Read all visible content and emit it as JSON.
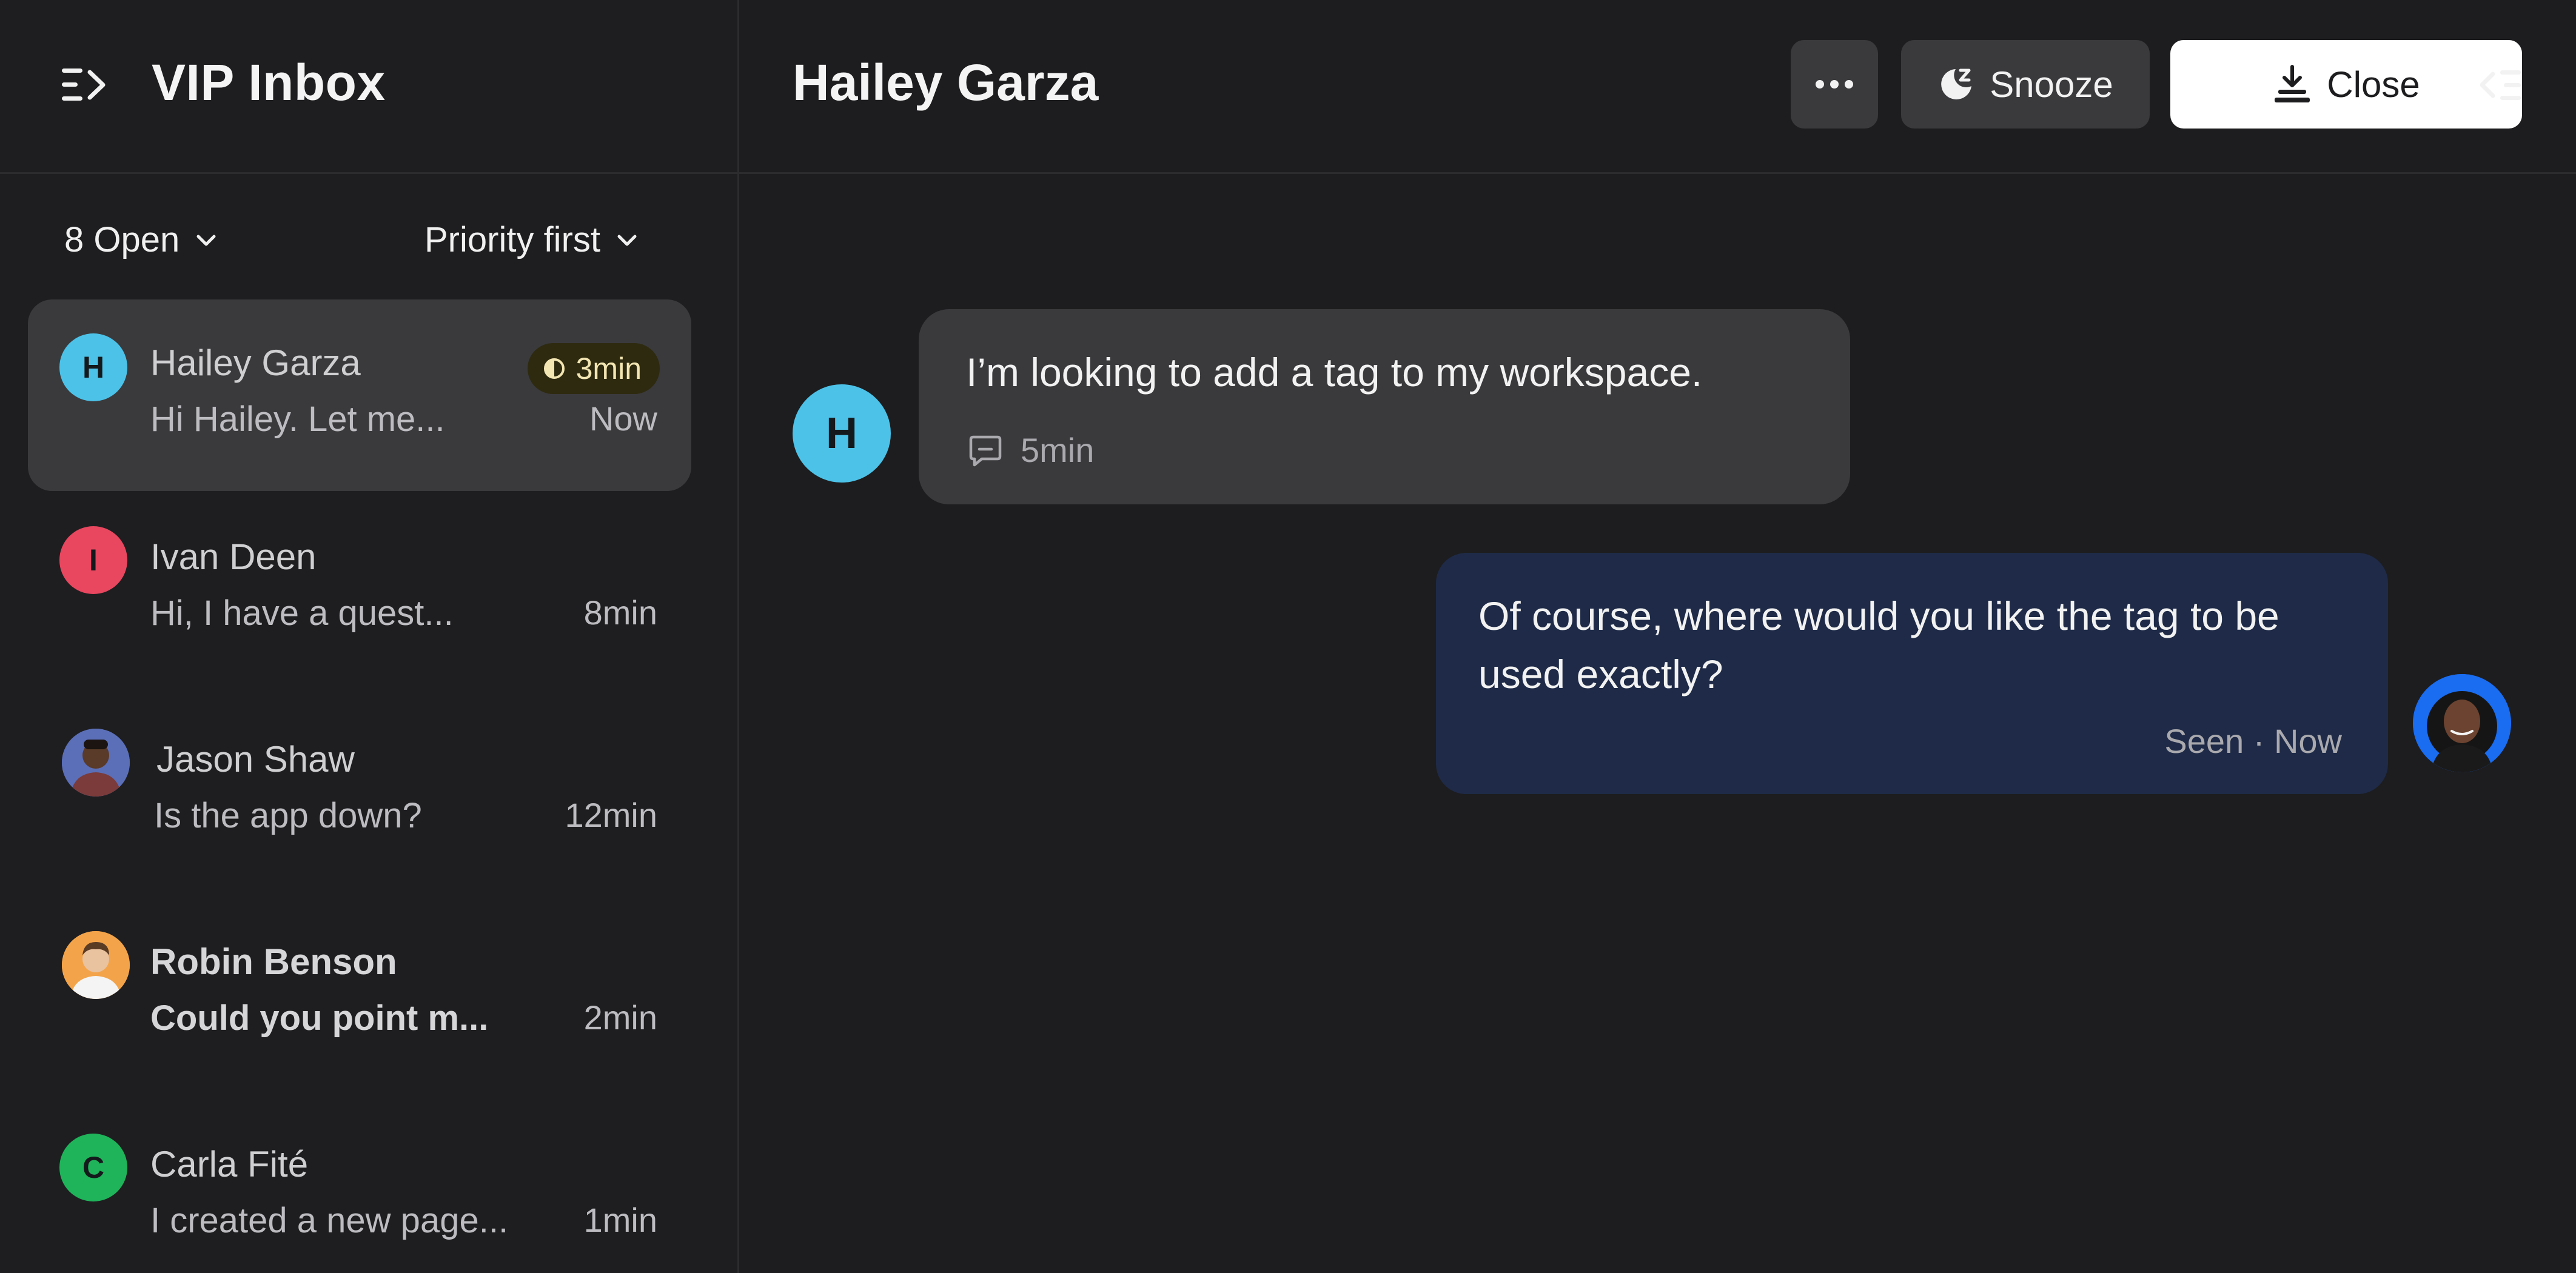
{
  "sidebar": {
    "title": "VIP Inbox",
    "filter_open": "8 Open",
    "filter_sort": "Priority first",
    "conversations": [
      {
        "initial": "H",
        "name": "Hailey Garza",
        "preview": "Hi Hailey. Let me...",
        "time": "Now",
        "badge": "3min",
        "avatar_color": "#4cc2e8",
        "active": true,
        "bold": false
      },
      {
        "initial": "I",
        "name": "Ivan Deen",
        "preview": "Hi, I have a quest...",
        "time": "8min",
        "avatar_color": "#e8475f",
        "active": false,
        "bold": false
      },
      {
        "initial": "",
        "name": "Jason Shaw",
        "preview": "Is the app down?",
        "time": "12min",
        "avatar_color": "#5b6fb8",
        "active": false,
        "bold": false
      },
      {
        "initial": "",
        "name": "Robin Benson",
        "preview": "Could you point m...",
        "time": "2min",
        "avatar_color": "#f3a44a",
        "active": false,
        "bold": true
      },
      {
        "initial": "C",
        "name": "Carla Fité",
        "preview": "I created a new page...",
        "time": "1min",
        "avatar_color": "#1fb35a",
        "active": false,
        "bold": false
      }
    ]
  },
  "header": {
    "contact_name": "Hailey Garza",
    "snooze_label": "Snooze",
    "close_label": "Close"
  },
  "messages": {
    "incoming": {
      "initial": "H",
      "text": "I’m looking to add a tag to my workspace.",
      "meta": "5min"
    },
    "outgoing": {
      "text": "Of course, where would you like the tag to be used exactly?",
      "meta": "Seen · Now"
    }
  },
  "colors": {
    "background": "#1d1d1f",
    "bubble_in": "#3a3a3d",
    "bubble_out": "#1e2a47",
    "accent_blue": "#1a6cf0",
    "badge_bg": "#2e2a10"
  }
}
